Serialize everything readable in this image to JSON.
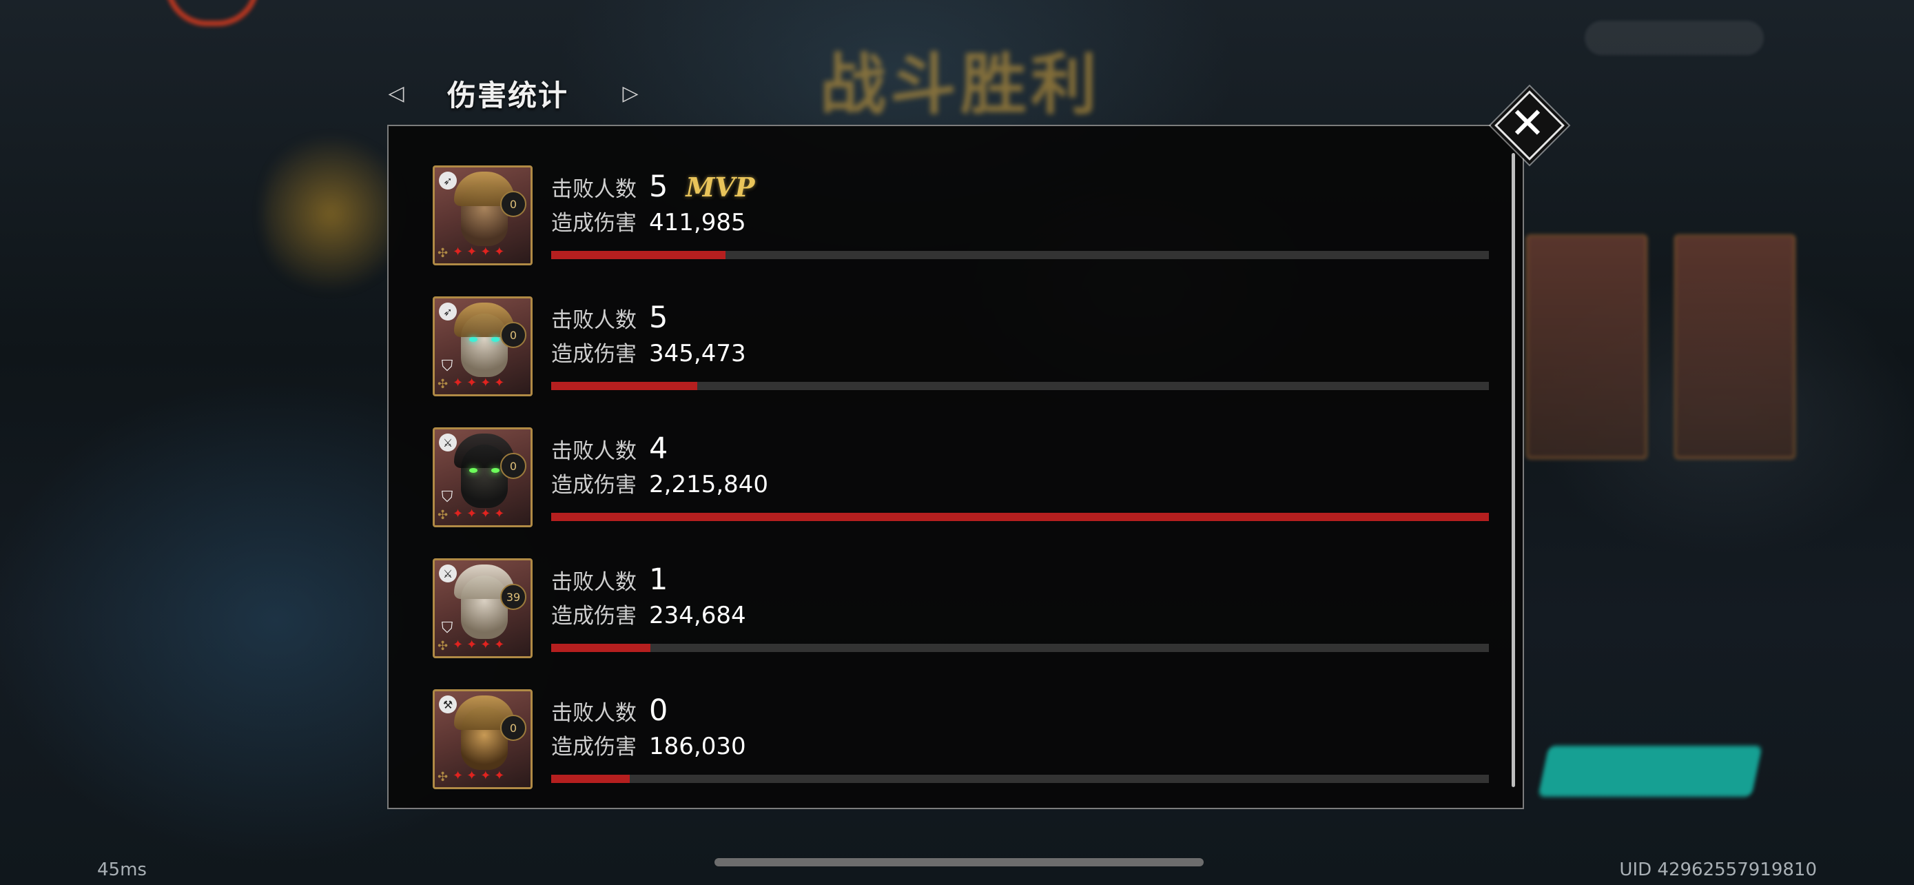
{
  "screen": {
    "background_title": "战斗胜利",
    "ping": "45ms",
    "uid": "UID 42962557919810"
  },
  "header": {
    "title": "伤害统计",
    "prev_icon": "triangle-left-icon",
    "next_icon": "triangle-right-icon"
  },
  "close_icon": "close-x-icon",
  "labels": {
    "kills": "击败人数",
    "damage": "造成伤害",
    "mvp": "MVP"
  },
  "colors": {
    "bar_fill": "#b51f1f",
    "bar_track": "#333333",
    "mvp_gold": "#e9c45a",
    "frame_gold": "#b08a45"
  },
  "heroes": [
    {
      "kills": "5",
      "damage": "411,985",
      "damage_value": 411985,
      "level": "0",
      "stars": 4,
      "mvp": true,
      "class_icon": "bow-icon"
    },
    {
      "kills": "5",
      "damage": "345,473",
      "damage_value": 345473,
      "level": "0",
      "stars": 4,
      "mvp": false,
      "class_icon": "bow-icon"
    },
    {
      "kills": "4",
      "damage": "2,215,840",
      "damage_value": 2215840,
      "level": "0",
      "stars": 4,
      "mvp": false,
      "class_icon": "sword-icon"
    },
    {
      "kills": "1",
      "damage": "234,684",
      "damage_value": 234684,
      "level": "39",
      "stars": 4,
      "mvp": false,
      "class_icon": "sword-icon"
    },
    {
      "kills": "0",
      "damage": "186,030",
      "damage_value": 186030,
      "level": "0",
      "stars": 4,
      "mvp": false,
      "class_icon": "axe-icon"
    }
  ]
}
